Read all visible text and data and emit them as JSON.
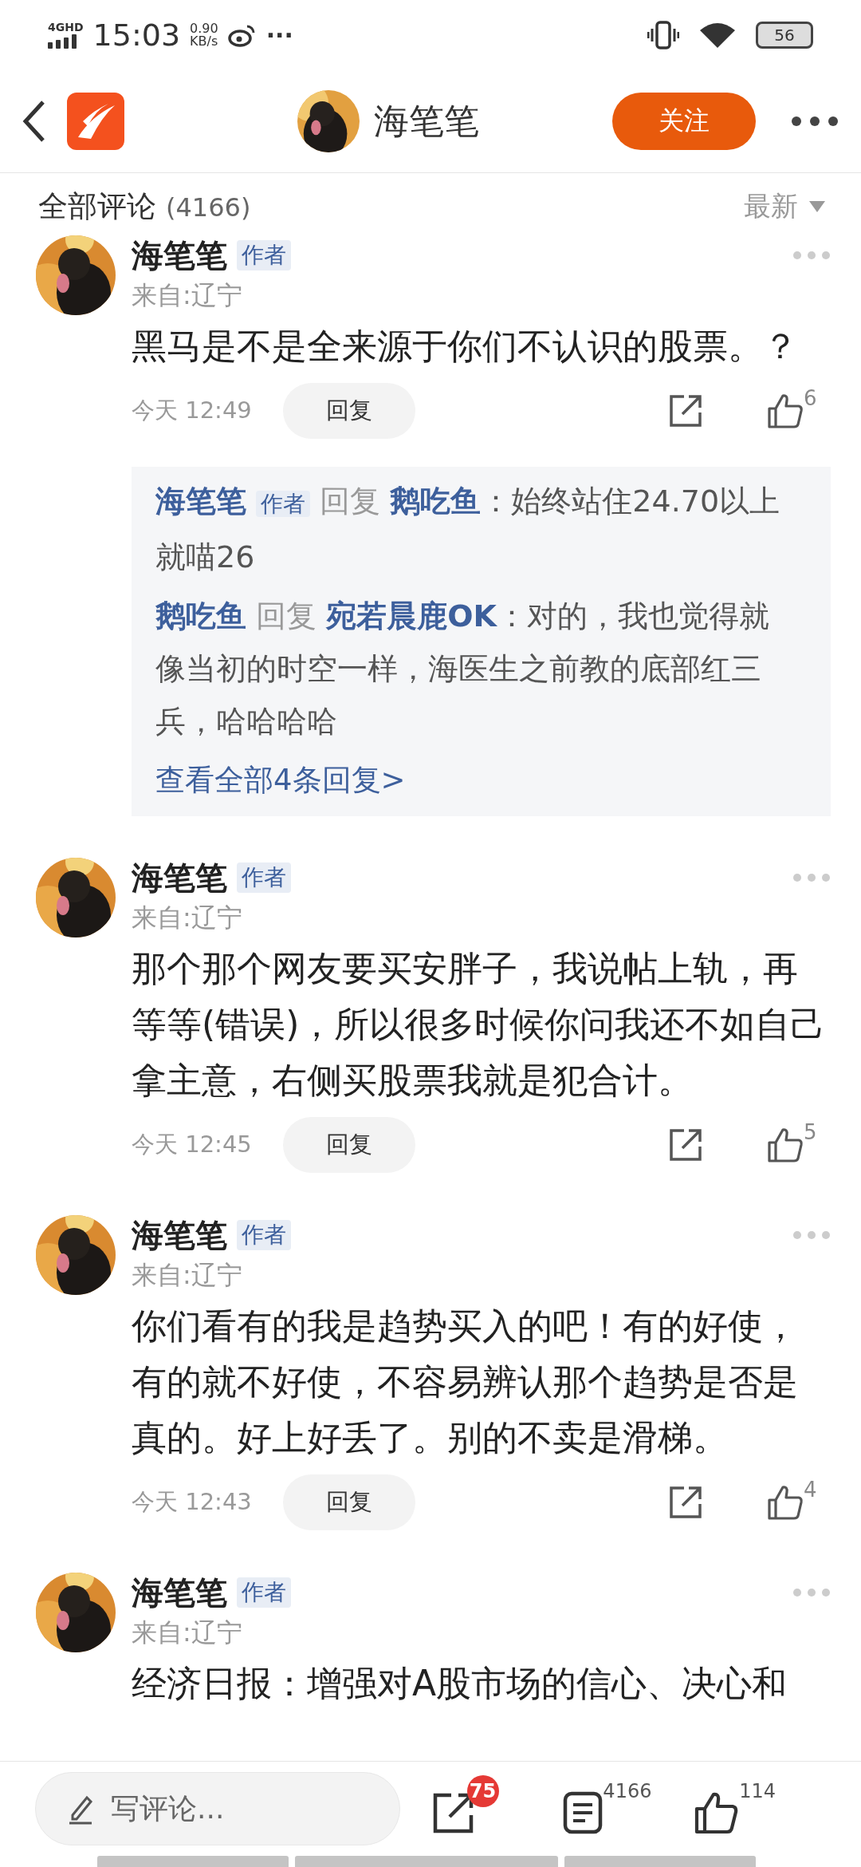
{
  "status_bar": {
    "network": "4GHD",
    "time": "15:03",
    "speed": "0.90",
    "speed_unit": "KB/s",
    "more": "···",
    "battery": "56"
  },
  "header": {
    "title": "海笔笔",
    "follow_button": "关注"
  },
  "comments_header": {
    "title": "全部评论",
    "count": "(4166)",
    "sort": "最新"
  },
  "comments": [
    {
      "name": "海笔笔",
      "badge": "作者",
      "location": "来自:辽宁",
      "text": "黑马是不是全来源于你们不认识的股票。？",
      "time": "今天 12:49",
      "reply_button": "回复",
      "likes": "6",
      "replies": [
        {
          "author": "海笔笔",
          "badge": "作者",
          "verb": "回复",
          "target": "鹅吃鱼",
          "text": "：始终站住24.70以上就喵26"
        },
        {
          "author": "鹅吃鱼",
          "verb": "回复",
          "target": "宛若晨鹿OK",
          "text": "：对的，我也觉得就像当初的时空一样，海医生之前教的底部红三兵，哈哈哈哈"
        }
      ],
      "view_all": "查看全部4条回复>"
    },
    {
      "name": "海笔笔",
      "badge": "作者",
      "location": "来自:辽宁",
      "text": "那个那个网友要买安胖子，我说帖上轨，再等等(错误)，所以很多时候你问我还不如自己拿主意，右侧买股票我就是犯合计。",
      "time": "今天 12:45",
      "reply_button": "回复",
      "likes": "5"
    },
    {
      "name": "海笔笔",
      "badge": "作者",
      "location": "来自:辽宁",
      "text": "你们看有的我是趋势买入的吧！有的好使，有的就不好使，不容易辨认那个趋势是否是真的。好上好丢了。别的不卖是滑梯。",
      "time": "今天 12:43",
      "reply_button": "回复",
      "likes": "4"
    },
    {
      "name": "海笔笔",
      "badge": "作者",
      "location": "来自:辽宁",
      "text": "经济日报：增强对A股市场的信心、决心和"
    }
  ],
  "bottom_bar": {
    "placeholder": "写评论...",
    "share_badge": "75",
    "comment_count": "4166",
    "like_count": "114"
  }
}
